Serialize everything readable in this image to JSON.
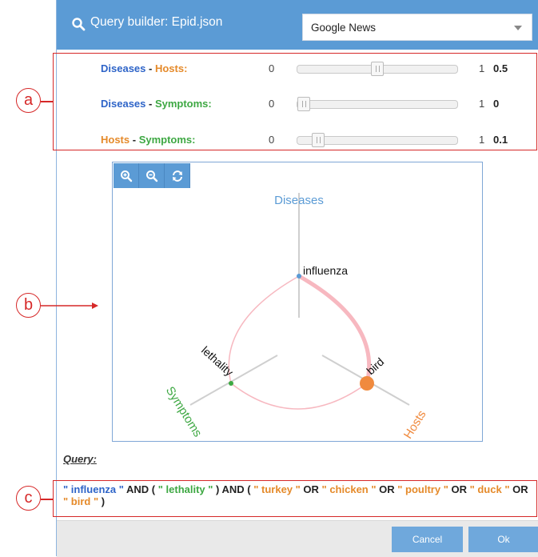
{
  "dialog": {
    "title": "Query builder: Epid.json",
    "source_select": {
      "selected": "Google News"
    }
  },
  "sliders": [
    {
      "label_a": "Diseases",
      "sep": " - ",
      "label_b": "Hosts",
      "colon": ":",
      "min": "0",
      "max": "1",
      "value": "0.5",
      "fraction": 0.5,
      "color_a": "#2e64c8",
      "color_b": "#e58a2a"
    },
    {
      "label_a": "Diseases",
      "sep": " - ",
      "label_b": "Symptoms",
      "colon": ":",
      "min": "0",
      "max": "1",
      "value": "0",
      "fraction": 0.0,
      "color_a": "#2e64c8",
      "color_b": "#3ea843"
    },
    {
      "label_a": "Hosts",
      "sep": " - ",
      "label_b": "Symptoms",
      "colon": ":",
      "min": "0",
      "max": "1",
      "value": "0.1",
      "fraction": 0.1,
      "color_a": "#e58a2a",
      "color_b": "#3ea843"
    }
  ],
  "graph": {
    "toolbar": {
      "icons": [
        "zoom-in-icon",
        "zoom-out-icon",
        "refresh-icon"
      ]
    },
    "axes": {
      "diseases": "Diseases",
      "hosts": "Hosts",
      "symptoms": "Symptoms"
    },
    "nodes": {
      "influenza": "influenza",
      "lethality": "lethality",
      "bird": "bird"
    }
  },
  "query": {
    "label": "Query:",
    "t1": "\" influenza \"",
    "t2": " AND ( ",
    "t3": "\" lethality \"",
    "t4": " ) AND ( ",
    "t5": "\" turkey \"",
    "t6": " OR ",
    "t7": "\" chicken \"",
    "t8": " OR ",
    "t9": "\" poultry \"",
    "t10": " OR ",
    "t11": "\" duck \"",
    "t12": " OR ",
    "t13": "\" bird \"",
    "t14": " )"
  },
  "buttons": {
    "cancel": "Cancel",
    "ok": "Ok"
  },
  "annotations": {
    "a": "a",
    "b": "b",
    "c": "c"
  },
  "colors": {
    "accent": "#5b9bd5",
    "annotation": "#d62828",
    "diseases": "#2e64c8",
    "hosts": "#e58a2a",
    "symptoms": "#3ea843"
  }
}
